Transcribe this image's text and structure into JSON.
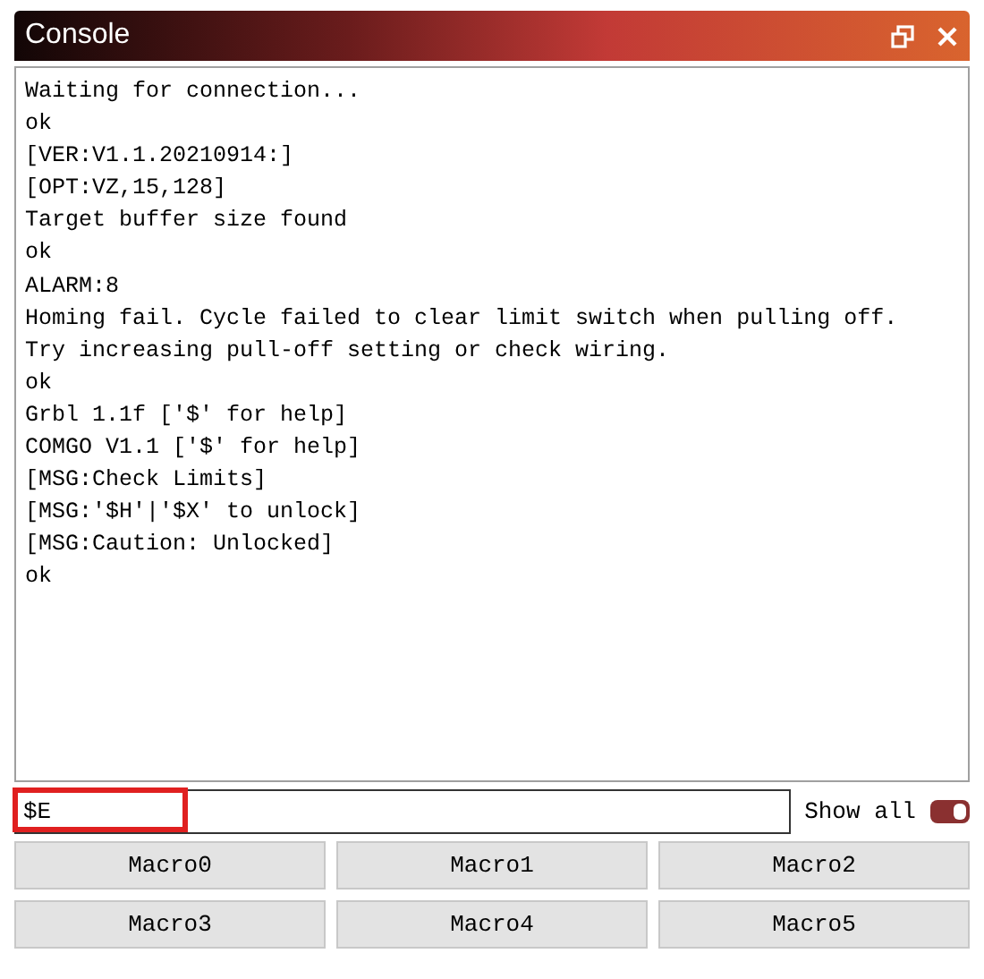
{
  "window": {
    "title": "Console"
  },
  "console_lines": [
    "Waiting for connection...",
    "ok",
    "[VER:V1.1.20210914:]",
    "[OPT:VZ,15,128]",
    "Target buffer size found",
    "ok",
    "ALARM:8",
    "Homing fail. Cycle failed to clear limit switch when pulling off.",
    "Try increasing pull-off setting or check wiring.",
    "ok",
    "Grbl 1.1f ['$' for help]",
    "COMGO V1.1 ['$' for help]",
    "[MSG:Check Limits]",
    "[MSG:'$H'|'$X' to unlock]",
    "[MSG:Caution: Unlocked]",
    "ok"
  ],
  "command": {
    "value": "$E",
    "highlighted": true
  },
  "show_all": {
    "label": "Show all",
    "on": true
  },
  "macros": [
    "Macro0",
    "Macro1",
    "Macro2",
    "Macro3",
    "Macro4",
    "Macro5"
  ]
}
